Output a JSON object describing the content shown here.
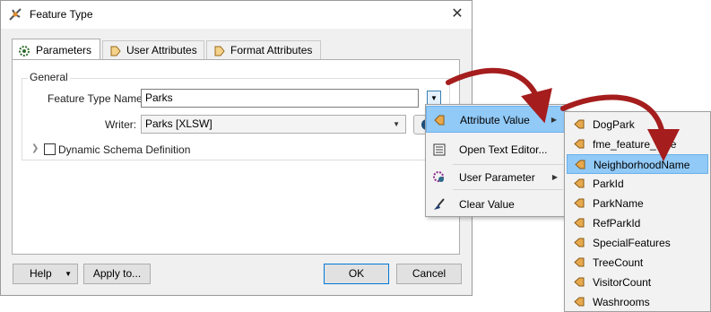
{
  "window": {
    "title": "Feature Type",
    "close_glyph": "✕"
  },
  "tabs": [
    {
      "label": "Parameters",
      "icon": "gear-icon"
    },
    {
      "label": "User Attributes",
      "icon": "attribute-arrow-icon"
    },
    {
      "label": "Format Attributes",
      "icon": "attribute-arrow-icon"
    }
  ],
  "general": {
    "group_label": "General",
    "feature_type_name_label": "Feature Type Name:",
    "feature_type_name_value": "Parks",
    "writer_label": "Writer:",
    "writer_value": "Parks [XLSW]",
    "dynamic_schema_label": "Dynamic Schema Definition"
  },
  "buttons": {
    "help": "Help",
    "apply_to": "Apply to...",
    "ok": "OK",
    "cancel": "Cancel"
  },
  "context_menu": [
    {
      "label": "Attribute Value",
      "has_submenu": true
    },
    {
      "label": "Open Text Editor...",
      "has_submenu": false
    },
    {
      "label": "User Parameter",
      "has_submenu": true
    },
    {
      "label": "Clear Value",
      "has_submenu": false
    }
  ],
  "attribute_list": [
    "DogPark",
    "fme_feature_type",
    "NeighborhoodName",
    "ParkId",
    "ParkName",
    "RefParkId",
    "SpecialFeatures",
    "TreeCount",
    "VisitorCount",
    "Washrooms"
  ],
  "selected_attribute": "NeighborhoodName",
  "colors": {
    "highlight": "#91c9f7",
    "arrow": "#a51d1d",
    "attr_icon": "#d9a35a"
  }
}
